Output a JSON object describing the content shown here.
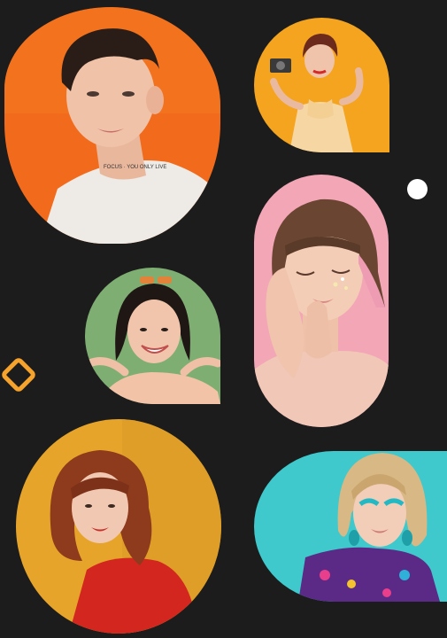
{
  "colors": {
    "background": "#1c1c1c",
    "accent_dot": "#ffffff",
    "accent_diamond": "#f5a32d",
    "photo_bg_orange": "#f26a1b",
    "photo_bg_amber": "#f4a41f",
    "photo_bg_pink": "#f3a6b6",
    "photo_bg_green": "#7fae73",
    "photo_bg_gold": "#e6a52a",
    "photo_bg_turquoise": "#3fc9cc"
  },
  "photos": [
    {
      "subject": "young man with curly dark hair, white t-shirt",
      "icon": "portrait-photo"
    },
    {
      "subject": "woman in yellow dress holding vintage camera",
      "icon": "portrait-photo"
    },
    {
      "subject": "woman with bangs and pink hair tips, eyes closed",
      "icon": "portrait-photo"
    },
    {
      "subject": "smiling woman pointing at herself",
      "icon": "portrait-photo"
    },
    {
      "subject": "woman with wavy auburn hair, red top",
      "icon": "portrait-photo"
    },
    {
      "subject": "blonde woman with turquoise earrings and colorful shirt",
      "icon": "portrait-photo"
    }
  ],
  "shirt_print": "FOCUS · YOU ONLY LIVE"
}
